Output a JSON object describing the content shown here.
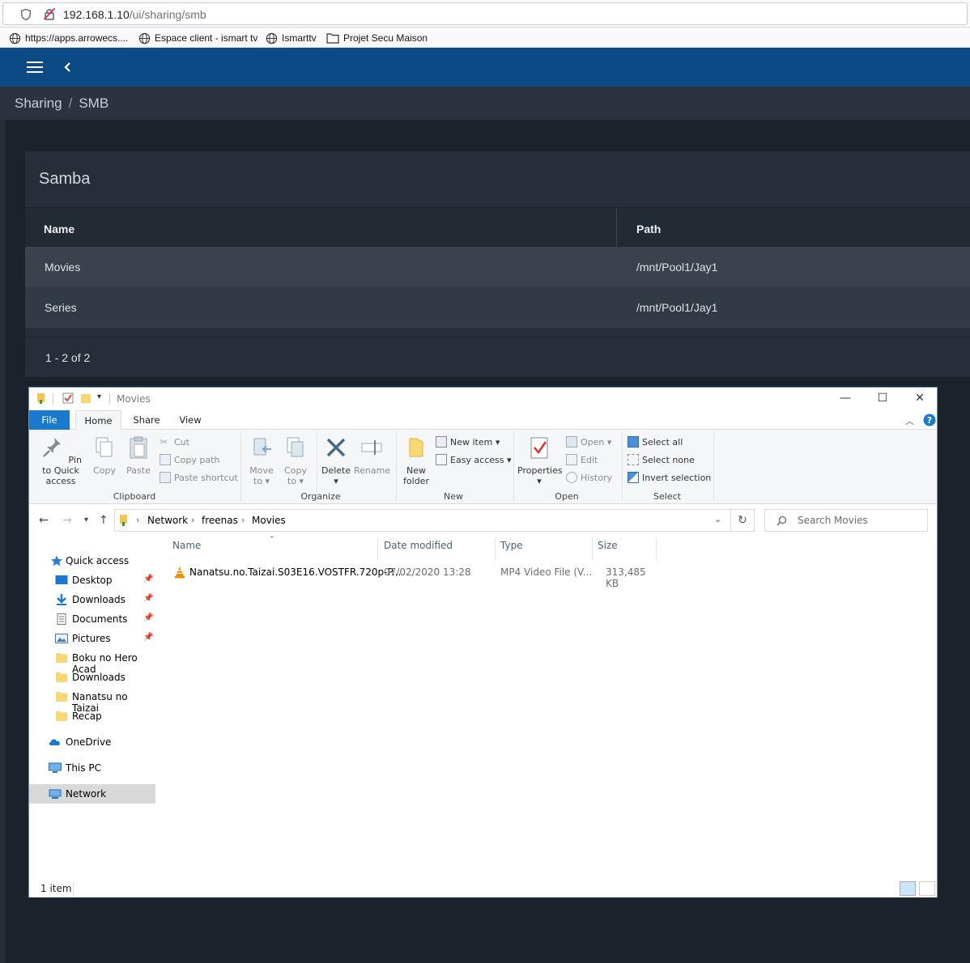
{
  "browser": {
    "url_host": "192.168.1.10",
    "url_path": "/ui/sharing/smb",
    "bookmarks": [
      {
        "label": "https://apps.arrowecs...."
      },
      {
        "label": "Espace client - ismart tv"
      },
      {
        "label": "Ismarttv"
      },
      {
        "label": "Projet Secu Maison"
      }
    ]
  },
  "breadcrumb": {
    "parent": "Sharing",
    "sep": "/",
    "current": "SMB"
  },
  "card": {
    "title": "Samba",
    "columns": {
      "name": "Name",
      "path": "Path"
    },
    "rows": [
      {
        "name": "Movies",
        "path": "/mnt/Pool1/Jay1"
      },
      {
        "name": "Series",
        "path": "/mnt/Pool1/Jay1"
      }
    ],
    "pagination": "1 - 2 of 2"
  },
  "explorer": {
    "title": "Movies",
    "tabs": {
      "file": "File",
      "home": "Home",
      "share": "Share",
      "view": "View"
    },
    "ribbon": {
      "pin_line1": "Pin to Quick",
      "pin_line2": "access",
      "copy": "Copy",
      "paste": "Paste",
      "cut": "Cut",
      "copy_path": "Copy path",
      "paste_shortcut": "Paste shortcut",
      "clipboard": "Clipboard",
      "move_to_1": "Move",
      "move_to_2": "to ▾",
      "copy_to_1": "Copy",
      "copy_to_2": "to ▾",
      "delete": "Delete",
      "delete_arrow": "▾",
      "rename": "Rename",
      "organize": "Organize",
      "new_item": "New item ▾",
      "easy_access": "Easy access ▾",
      "new_folder_1": "New",
      "new_folder_2": "folder",
      "new": "New",
      "properties": "Properties",
      "properties_arrow": "▾",
      "open_item": "Open ▾",
      "edit": "Edit",
      "history": "History",
      "open": "Open",
      "select_all": "Select all",
      "select_none": "Select none",
      "invert_selection": "Invert selection",
      "select": "Select"
    },
    "address": [
      "Network",
      "freenas",
      "Movies"
    ],
    "search_placeholder": "Search Movies",
    "nav": {
      "quick_access": "Quick access",
      "desktop": "Desktop",
      "downloads_pinned": "Downloads",
      "documents": "Documents",
      "pictures": "Pictures",
      "boku": "Boku no Hero Acad",
      "downloads": "Downloads",
      "nanatsu": "Nanatsu no Taizai",
      "recap": "Recap",
      "onedrive": "OneDrive",
      "thispc": "This PC",
      "network": "Network"
    },
    "columns": {
      "name": "Name",
      "date": "Date modified",
      "type": "Type",
      "size": "Size"
    },
    "files": [
      {
        "name": "Nanatsu.no.Taizai.S03E16.VOSTFR.720p-P...",
        "date": "07/02/2020 13:28",
        "type": "MP4 Video File (V...",
        "size": "313,485 KB"
      }
    ],
    "status": "1 item"
  }
}
